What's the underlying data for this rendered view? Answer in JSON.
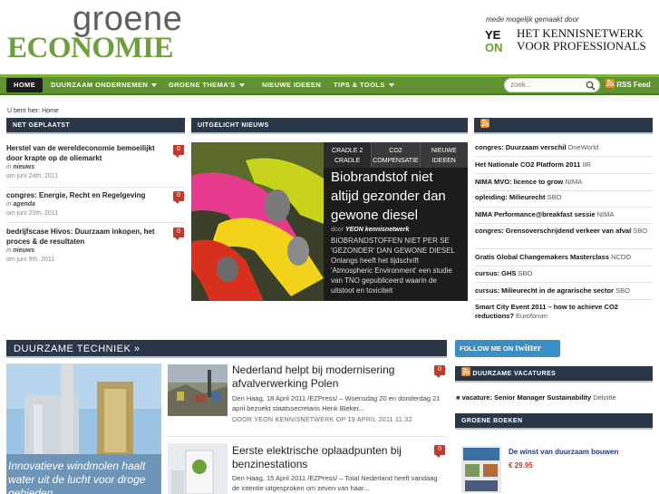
{
  "header": {
    "brand_top": "groene",
    "brand_bottom": "ECONOMIE",
    "sponsor_line": "mede mogelijk gemaakt door",
    "sponsor_logo_text": "YEON",
    "sponsor_name_1": "HET KENNISNETWERK",
    "sponsor_name_2": "VOOR PROFESSIONALS"
  },
  "nav": {
    "items": [
      {
        "label": "HOME",
        "dropdown": false
      },
      {
        "label": "DUURZAAM ONDERNEMEN",
        "dropdown": true
      },
      {
        "label": "GROENE THEMA'S",
        "dropdown": true
      },
      {
        "label": "NIEUWE IDEEEN",
        "dropdown": false
      },
      {
        "label": "TIPS & TOOLS",
        "dropdown": true
      }
    ],
    "search_placeholder": "zoek...",
    "rss_label": "RSS Feed"
  },
  "breadcrumb": "U bent hier: Home",
  "net_geplaatst": {
    "heading": "NET GEPLAATST",
    "items": [
      {
        "title": "Herstel van de wereldeconomie bemoeilijkt door krapte op de oliemarkt",
        "in_prefix": "in",
        "category": "nieuws",
        "date": "om juni 24th, 2011",
        "comments": "0"
      },
      {
        "title": "congres: Energie, Recht en Regelgeving",
        "in_prefix": "in",
        "category": "agenda",
        "date": "om juni 20th, 2011",
        "comments": "0"
      },
      {
        "title": "bedrijfscase Hivos: Duurzaam inkopen, het proces & de resultaten",
        "in_prefix": "in",
        "category": "nieuws",
        "date": "om juni 9th, 2011",
        "comments": "0"
      }
    ]
  },
  "uitgelicht": {
    "heading": "UITGELICHT NIEUWS",
    "tabs": [
      "CRADLE 2 CRADLE",
      "CO2 COMPENSATIE",
      "NIEUWE IDEEEN"
    ],
    "title": "Biobrandstof niet altijd gezonder dan gewone diesel",
    "by_prefix": "door",
    "author": "YEON kennisnetwerk",
    "body": "BIOBRANDSTOFFEN NIET PER SE 'GEZONDER' DAN GEWONE DIESEL Onlangs heeft het tijdschrift 'Atmospheric Environment' een studie van TNO gepubliceerd waarin de uitstoot en toxiciteit"
  },
  "right_list": {
    "items": [
      {
        "title": "congres: Duurzaam verschil",
        "source": "OneWorld"
      },
      {
        "title": "Het Nationale CO2 Platform 2011",
        "source": "IIR"
      },
      {
        "title": "NIMA MVO: licence to grow",
        "source": "NIMA"
      },
      {
        "title": "opleiding: Milieurecht",
        "source": "SBO"
      },
      {
        "title": "NIMA Performance@breakfast sessie",
        "source": "NIMA"
      },
      {
        "title": "congres: Grensoverschrijdend verkeer van afval",
        "source": "SBO"
      },
      {
        "title": "Gratis Global Changemakers Masterclass",
        "source": "NCDO"
      },
      {
        "title": "cursus: GHS",
        "source": "SBO"
      },
      {
        "title": "cursus: Milieurecht in de agrarische sector",
        "source": "SBO"
      },
      {
        "title": "Smart City Event 2011 – how to achieve CO2 reductions?",
        "source": "Euroforum"
      }
    ]
  },
  "techniek": {
    "heading": "DUURZAME TECHNIEK »",
    "lead_caption": "Innovatieve windmolen haalt water uit de lucht voor droge gebieden",
    "stories": [
      {
        "title": "Nederland helpt bij modernisering afvalverwerking Polen",
        "body": "Den Haag, 18 April 2011 /EZPress/ – Woensdag 20 en donderdag 21 april bezoekt staatssecretaris Henk Bleker...",
        "byline": "DOOR YEON KENNISNETWERK OP 19 APRIL 2011 11:32",
        "comments": "0"
      },
      {
        "title": "Eerste elektrische oplaadpunten bij benzinestations",
        "body": "Den Haag, 15 April 2011 /EZPress/ – Total Nederland heeft vandaag de intentie uitgesproken om zeven van haar...",
        "comments": "0"
      }
    ]
  },
  "twitter": {
    "prefix": "FOLLOW ME ON",
    "brand": "twitter"
  },
  "vacatures": {
    "heading": "DUURZAME VACATURES",
    "items": [
      {
        "title": "vacature: Senior Manager Sustainability",
        "source": "Deloitte"
      }
    ]
  },
  "boeken": {
    "heading": "GROENE BOEKEN",
    "items": [
      {
        "title": "De winst van duurzaam bouwen",
        "price": "€ 29.95"
      }
    ]
  },
  "colors": {
    "nav_green": "#5f9331",
    "header_navy": "#2a3747",
    "badge_red": "#c0392b",
    "brand_green": "#6ea03a",
    "twitter_blue": "#3a8fc7"
  }
}
